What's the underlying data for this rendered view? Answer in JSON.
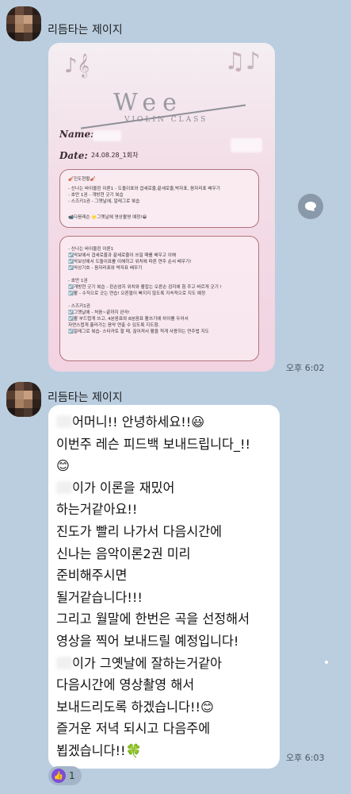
{
  "colors": {
    "background": "#bacee0",
    "bubble": "#ffffff",
    "time": "#4a5562",
    "card_border": "#b2727c"
  },
  "messages": [
    {
      "sender": "리듬타는 제이지",
      "type": "image",
      "time": "오후 6:02",
      "card": {
        "logo": "Wee",
        "logo_sub": "VIOLIN CLASS",
        "name_label": "Name:",
        "date_label": "Date:",
        "date_value": "24.08.28_1회차",
        "box1": [
          "🎻진도현황🎻",
          "- 신나는 바이올린 이론1 - 도돌이표와 겹세로줄,끝세로줄,박자표, 음자리표 배우기",
          "- 호만 1권 - 개방현 긋기 복습",
          "- 스즈키1권 - 그옛날에, 알레그로 복습",
          "",
          "📹다음레슨 🌟그옛날에 영상촬영 예정!😁"
        ],
        "box2": [
          "- 신나는 바이올린 이론1",
          "☑️악보에서 겹세로줄과 끝세로줄이 쓰일 때를 배우고 이해",
          "☑️악보상에서 도돌이표를 이해하고 위치에 따른 연주 순서 배우기!",
          "☑️악상기호 - 음자리표와 박자표 배우기",
          "",
          "- 호만 1권",
          "☑️개방현 긋기 복습 - 왼손엄지 위치와 활잡는 오른손 검지에 힘 주고 바르게 긋기 !",
          "☑️활 - 수직으로 긋는 연습! 오른팔이 빠지지 않도록 지속적으로 지도 예정",
          "",
          "- 스즈키1권",
          "☑️그옛날에 - 처음~끝까지 완곡!",
          "☑️활 부드럽게 쓰고, 4분음표와 8분음표 활쓰기에 차이를 두어서",
          "자연스럽게 흘러가는 음악 연출 수 있도록 지도함.",
          "☑️알레그로 복습- 스타카토 할 때, 끊어져서 활을 적게 사용하는 연주법 지도"
        ]
      }
    },
    {
      "sender": "리듬타는 제이지",
      "type": "text",
      "time": "오후 6:03",
      "lines": [
        "어머니!! 안녕하세요!!😃",
        "이번주 레슨 피드백 보내드립니다_!!",
        "😊",
        "이가 이론을 재밌어",
        "하는거같아요!!",
        "진도가 빨리 나가서 다음시간에",
        "신나는 음악이론2권 미리",
        "준비해주시면",
        "될거같습니다!!!",
        "그리고 월말에 한번은 곡을 선정해서",
        "영상을 찍어 보내드릴 예정입니다!",
        "이가 그옛날에 잘하는거같아",
        "다음시간에 영상촬영 해서",
        "보내드리도록 하겠습니다!!😊",
        "즐거운 저녁 되시고 다음주에",
        "뵙겠습니다!!🍀"
      ],
      "reaction": {
        "icon": "thumbs-up",
        "count": "1"
      }
    }
  ]
}
